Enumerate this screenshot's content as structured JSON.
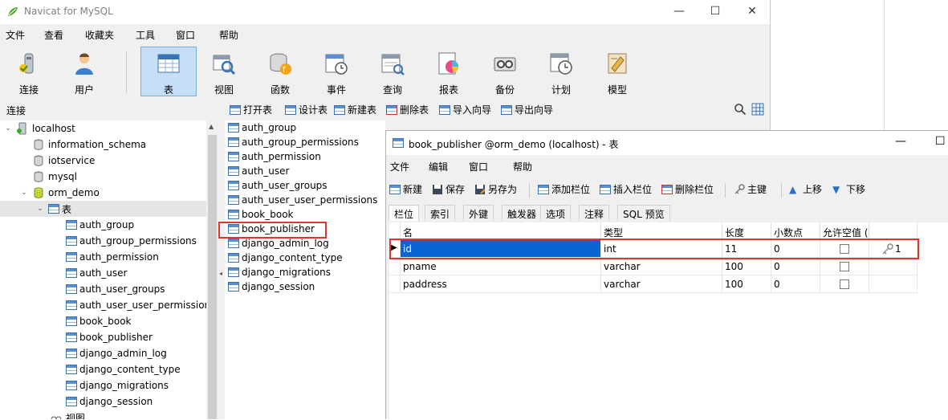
{
  "window": {
    "title": "Navicat for MySQL",
    "controls": [
      "—",
      "☐",
      "✕"
    ]
  },
  "menu": [
    "文件",
    "查看",
    "收藏夹",
    "工具",
    "窗口",
    "帮助"
  ],
  "toolbar": [
    {
      "label": "连接",
      "icon": "connection-icon"
    },
    {
      "label": "用户",
      "icon": "user-icon"
    },
    {
      "label": "表",
      "icon": "table-icon",
      "active": true
    },
    {
      "label": "视图",
      "icon": "view-icon"
    },
    {
      "label": "函数",
      "icon": "function-icon"
    },
    {
      "label": "事件",
      "icon": "event-icon"
    },
    {
      "label": "查询",
      "icon": "query-icon"
    },
    {
      "label": "报表",
      "icon": "report-icon"
    },
    {
      "label": "备份",
      "icon": "backup-icon"
    },
    {
      "label": "计划",
      "icon": "schedule-icon"
    },
    {
      "label": "模型",
      "icon": "model-icon"
    }
  ],
  "connection_header": "连接",
  "object_toolbar": [
    "打开表",
    "设计表",
    "新建表",
    "删除表",
    "导入向导",
    "导出向导"
  ],
  "tree": {
    "root": "localhost",
    "databases": [
      "information_schema",
      "iotservice",
      "mysql",
      "orm_demo"
    ],
    "tables_node": "表",
    "tables": [
      "auth_group",
      "auth_group_permissions",
      "auth_permission",
      "auth_user",
      "auth_user_groups",
      "auth_user_user_permission",
      "book_book",
      "book_publisher",
      "django_admin_log",
      "django_content_type",
      "django_migrations",
      "django_session"
    ],
    "views_node": "视图"
  },
  "object_list": [
    "auth_group",
    "auth_group_permissions",
    "auth_permission",
    "auth_user",
    "auth_user_groups",
    "auth_user_user_permissions",
    "book_book",
    "book_publisher",
    "django_admin_log",
    "django_content_type",
    "django_migrations",
    "django_session"
  ],
  "designer": {
    "title": "book_publisher @orm_demo (localhost) - 表",
    "menu": [
      "文件",
      "编辑",
      "窗口",
      "帮助"
    ],
    "toolbar": [
      "新建",
      "保存",
      "另存为",
      "添加栏位",
      "插入栏位",
      "删除栏位",
      "主键",
      "上移",
      "下移"
    ],
    "tabs": [
      "栏位",
      "索引",
      "外键",
      "触发器",
      "选项",
      "注释",
      "SQL 预览"
    ],
    "columns": [
      "名",
      "类型",
      "长度",
      "小数点",
      "允许空值 (",
      ""
    ],
    "rows": [
      {
        "name": "id",
        "type": "int",
        "length": "11",
        "decimals": "0",
        "key": "1"
      },
      {
        "name": "pname",
        "type": "varchar",
        "length": "100",
        "decimals": "0",
        "key": ""
      },
      {
        "name": "paddress",
        "type": "varchar",
        "length": "100",
        "decimals": "0",
        "key": ""
      }
    ]
  }
}
